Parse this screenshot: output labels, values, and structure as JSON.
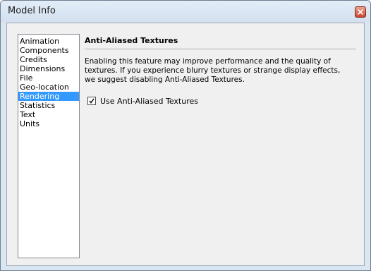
{
  "window": {
    "title": "Model Info"
  },
  "sidebar": {
    "items": [
      {
        "label": "Animation",
        "selected": false
      },
      {
        "label": "Components",
        "selected": false
      },
      {
        "label": "Credits",
        "selected": false
      },
      {
        "label": "Dimensions",
        "selected": false
      },
      {
        "label": "File",
        "selected": false
      },
      {
        "label": "Geo-location",
        "selected": false
      },
      {
        "label": "Rendering",
        "selected": true
      },
      {
        "label": "Statistics",
        "selected": false
      },
      {
        "label": "Text",
        "selected": false
      },
      {
        "label": "Units",
        "selected": false
      }
    ]
  },
  "main": {
    "section_title": "Anti-Aliased Textures",
    "description_lines": [
      "Enabling this feature may improve performance and the quality of",
      "textures. If you experience blurry textures or strange display effects,",
      "we suggest disabling Anti-Aliased Textures."
    ],
    "checkbox": {
      "label": "Use Anti-Aliased Textures",
      "checked": true
    }
  },
  "icons": {
    "close": "close-icon",
    "check": "checkmark-icon"
  },
  "colors": {
    "selection": "#3399ff",
    "close_button": "#c8452d",
    "window_frame": "#dbe6f3"
  }
}
